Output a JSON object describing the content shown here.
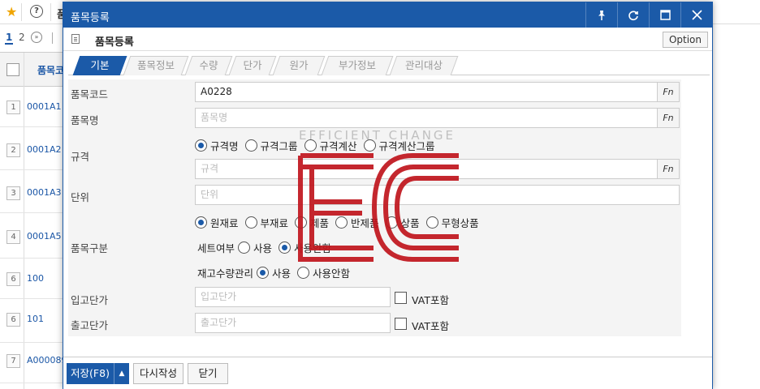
{
  "background": {
    "title_peek": "품",
    "pager": {
      "page1": "1",
      "page2": "2",
      "next": "»"
    },
    "grid_header": "품목코",
    "rows": [
      {
        "num": "1",
        "code": "0001A1"
      },
      {
        "num": "2",
        "code": "0001A2"
      },
      {
        "num": "3",
        "code": "0001A3"
      },
      {
        "num": "4",
        "code": "0001A5"
      },
      {
        "num": "6",
        "code": "100"
      },
      {
        "num": "6",
        "code": "101"
      },
      {
        "num": "7",
        "code": "A000089"
      }
    ]
  },
  "dialog": {
    "title": "품목등록",
    "header_title": "품목등록",
    "option_label": "Option",
    "tabs": [
      "기본",
      "품목정보",
      "수량",
      "단가",
      "원가",
      "부가정보",
      "관리대상"
    ],
    "form": {
      "item_code": {
        "label": "품목코드",
        "value": "A0228",
        "fn": "Fn"
      },
      "item_name": {
        "label": "품목명",
        "placeholder": "품목명",
        "fn": "Fn"
      },
      "spec": {
        "label": "규격",
        "options": [
          "규격명",
          "규격그룹",
          "규격계산",
          "규격계산그룹"
        ],
        "selected": "규격명",
        "placeholder": "규격",
        "fn": "Fn"
      },
      "unit": {
        "label": "단위",
        "placeholder": "단위"
      },
      "item_type": {
        "label": "품목구분",
        "options": [
          "원재료",
          "부재료",
          "제품",
          "반제품",
          "상품",
          "무형상품"
        ],
        "selected": "원재료",
        "set_label": "세트여부",
        "set_options": [
          "사용",
          "사용안함"
        ],
        "set_selected": "사용안함",
        "stock_label": "재고수량관리",
        "stock_options": [
          "사용",
          "사용안함"
        ],
        "stock_selected": "사용"
      },
      "in_price": {
        "label": "입고단가",
        "placeholder": "입고단가",
        "vat_label": "VAT포함",
        "vat_checked": false
      },
      "out_price": {
        "label": "출고단가",
        "placeholder": "출고단가",
        "vat_label": "VAT포함",
        "vat_checked": false
      }
    },
    "footer": {
      "save_label": "저장(F8)",
      "rewrite_label": "다시작성",
      "close_label": "닫기"
    }
  },
  "watermark": {
    "text": "EFFICIENT CHANGE",
    "logo": "EC"
  },
  "colors": {
    "accent": "#1b5aa8",
    "watermark_red": "#c0151d"
  }
}
